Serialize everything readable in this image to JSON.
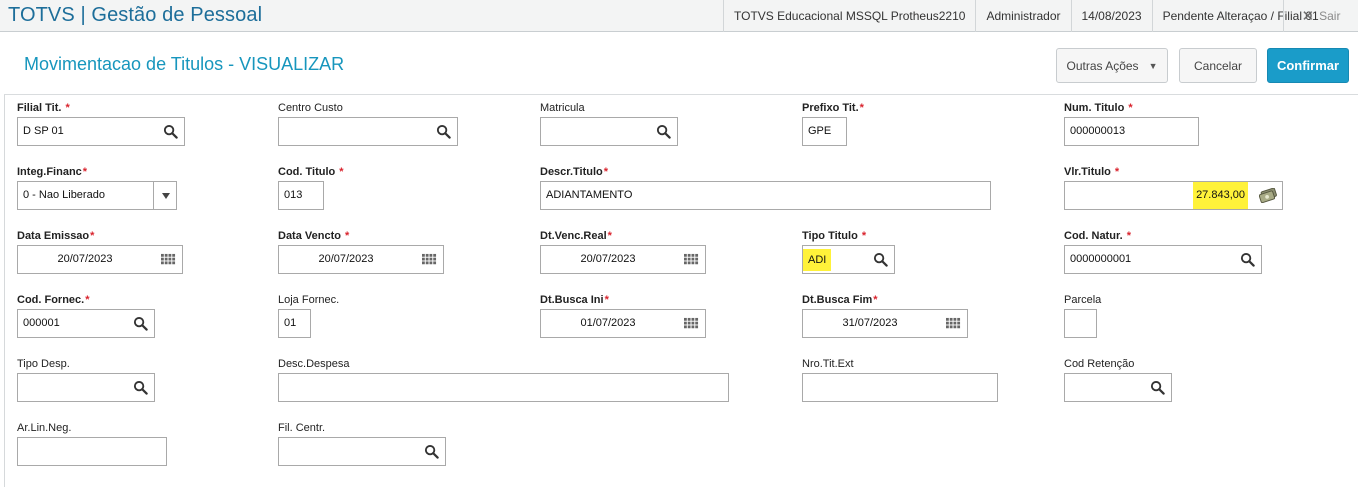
{
  "topbar": {
    "app_title": "TOTVS | Gestão de Pessoal",
    "environment": "TOTVS Educacional MSSQL Protheus2210",
    "user": "Administrador",
    "date": "14/08/2023",
    "status": "Pendente Alteraçao / Filial 01",
    "exit_label": "Sair"
  },
  "header": {
    "title": "Movimentacao de Titulos - VISUALIZAR",
    "outras_acoes_label": "Outras Ações",
    "cancelar_label": "Cancelar",
    "confirmar_label": "Confirmar"
  },
  "fields": {
    "filial_tit": {
      "label": "Filial Tit.",
      "required": "*",
      "value": "D SP 01"
    },
    "centro_custo": {
      "label": "Centro Custo",
      "value": ""
    },
    "matricula": {
      "label": "Matricula",
      "value": ""
    },
    "prefixo_tit": {
      "label": "Prefixo Tit.",
      "required": "*",
      "value": "GPE"
    },
    "num_titulo": {
      "label": "Num. Titulo",
      "required": "*",
      "value": "000000013"
    },
    "integ_financ": {
      "label": "Integ.Financ",
      "required": "*",
      "value": "0 - Nao Liberado"
    },
    "cod_titulo": {
      "label": "Cod. Titulo",
      "required": "*",
      "value": "013"
    },
    "descr_titulo": {
      "label": "Descr.Titulo",
      "required": "*",
      "value": "ADIANTAMENTO"
    },
    "vlr_titulo": {
      "label": "Vlr.Titulo",
      "required": "*",
      "value": "27.843,00"
    },
    "data_emissao": {
      "label": "Data Emissao",
      "required": "*",
      "value": "20/07/2023"
    },
    "data_vencto": {
      "label": "Data Vencto",
      "required": "*",
      "value": "20/07/2023"
    },
    "dt_venc_real": {
      "label": "Dt.Venc.Real",
      "required": "*",
      "value": "20/07/2023"
    },
    "tipo_titulo": {
      "label": "Tipo Titulo",
      "required": "*",
      "value": "ADI"
    },
    "cod_natur": {
      "label": "Cod. Natur.",
      "required": "*",
      "value": "0000000001"
    },
    "cod_fornec": {
      "label": "Cod. Fornec.",
      "required": "*",
      "value": "000001"
    },
    "loja_fornec": {
      "label": "Loja Fornec.",
      "value": "01"
    },
    "dt_busca_ini": {
      "label": "Dt.Busca Ini",
      "required": "*",
      "value": "01/07/2023"
    },
    "dt_busca_fim": {
      "label": "Dt.Busca Fim",
      "required": "*",
      "value": "31/07/2023"
    },
    "parcela": {
      "label": "Parcela",
      "value": ""
    },
    "tipo_desp": {
      "label": "Tipo Desp.",
      "value": ""
    },
    "desc_despesa": {
      "label": "Desc.Despesa",
      "value": ""
    },
    "nro_tit_ext": {
      "label": "Nro.Tit.Ext",
      "value": ""
    },
    "cod_retencao": {
      "label": "Cod Retenção",
      "value": ""
    },
    "ar_lin_neg": {
      "label": "Ar.Lin.Neg.",
      "value": ""
    },
    "fil_centr": {
      "label": "Fil. Centr.",
      "value": ""
    }
  },
  "colors": {
    "brand": "#1d6e9a",
    "title": "#1796bd",
    "primary_button": "#1a9cc9",
    "required_star": "#d9232d",
    "highlight": "#fff23a"
  }
}
